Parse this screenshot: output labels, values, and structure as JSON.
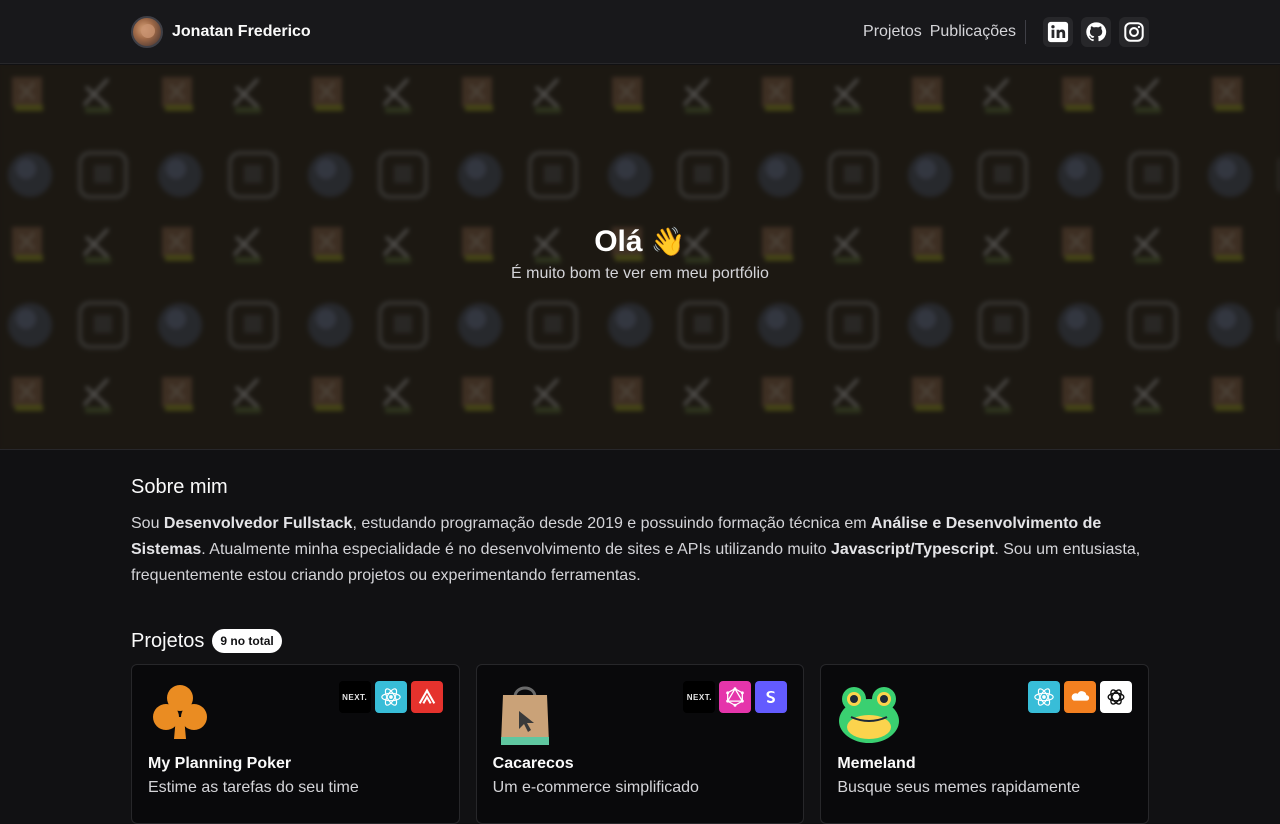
{
  "header": {
    "name": "Jonatan Frederico",
    "nav": [
      "Projetos",
      "Publicações"
    ],
    "social": [
      "linkedin-icon",
      "github-icon",
      "instagram-icon"
    ]
  },
  "hero": {
    "title": "Olá",
    "emoji": "👋",
    "subtitle": "É muito bom te ver em meu portfólio"
  },
  "about": {
    "title": "Sobre mim",
    "p1": "Sou ",
    "b1": "Desenvolvedor Fullstack",
    "p2": ", estudando programação desde 2019 e possuindo formação técnica em ",
    "b2": "Análise e Desenvolvimento de Sistemas",
    "p3": ". Atualmente minha especialidade é no desenvolvimento de sites e APIs utilizando muito ",
    "b3": "Javascript/Typescript",
    "p4": ". Sou um entusiasta, frequentemente estou criando projetos ou experimentando ferramentas."
  },
  "projects": {
    "title": "Projetos",
    "badge": "9 no total",
    "items": [
      {
        "title": "My Planning Poker",
        "desc": "Estime as tarefas do seu time",
        "icon": "club-icon",
        "tech": [
          "NEXT.",
          "react-icon",
          "sentry-icon"
        ]
      },
      {
        "title": "Cacarecos",
        "desc": "Um e-commerce simplificado",
        "icon": "shopping-bag-icon",
        "tech": [
          "NEXT.",
          "graphql-icon",
          "stripe-icon"
        ]
      },
      {
        "title": "Memeland",
        "desc": "Busque seus memes rapidamente",
        "icon": "frog-icon",
        "tech": [
          "react-icon",
          "cloudflare-icon",
          "openai-icon"
        ]
      }
    ]
  },
  "colors": {
    "background": "#111113",
    "header": "#18181b",
    "card": "#09090b",
    "club": "#f59e0b",
    "react": "#38bdf8",
    "sentry": "#e5322d",
    "graphql": "#e535ab",
    "stripe": "#635bff",
    "cloudflare": "#f38020"
  }
}
